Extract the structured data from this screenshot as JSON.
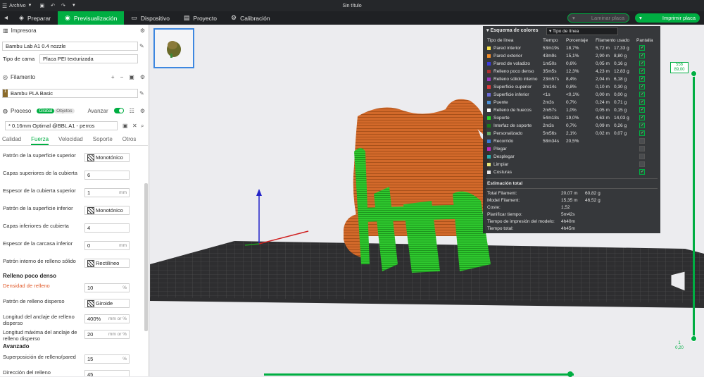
{
  "titlebar": {
    "menu_label": "Archivo",
    "title": "Sin título"
  },
  "nav": {
    "tabs": [
      {
        "label": "Preparar",
        "icon": "cube-icon"
      },
      {
        "label": "Previsualización",
        "icon": "preview-icon"
      },
      {
        "label": "Dispositivo",
        "icon": "monitor-icon"
      },
      {
        "label": "Proyecto",
        "icon": "folder-icon"
      },
      {
        "label": "Calibración",
        "icon": "calibration-icon"
      }
    ],
    "laminar_label": "Laminar placa",
    "imprimir_label": "Imprimir placa"
  },
  "sidebar": {
    "impresora_title": "Impresora",
    "printer_value": "Bambu Lab A1 0.4 nozzle",
    "bed_label": "Tipo de cama",
    "bed_value": "Placa PEI texturizada",
    "filamento_title": "Filamento",
    "filament_num": "1",
    "filament_value": "Bambu PLA Basic",
    "filament_color": "#8a6a2a",
    "proceso_title": "Proceso",
    "global_label": "Global",
    "objetos_label": "Objetos",
    "avanzar_label": "Avanzar",
    "process_value": "* 0.16mm Optimal @BBL A1 - perros",
    "tabs": [
      "Calidad",
      "Fuerza",
      "Velocidad",
      "Soporte",
      "Otros"
    ],
    "params": [
      {
        "label": "Patrón de la superficie superior",
        "value": "Monotónico",
        "unit": "",
        "pattern": true
      },
      {
        "label": "Capas superiores de la cubierta",
        "value": "6",
        "unit": "",
        "pattern": false
      },
      {
        "label": "Espesor de la cubierta superior",
        "value": "1",
        "unit": "mm",
        "pattern": false
      },
      {
        "label": "Patrón de la superficie inferior",
        "value": "Monotónico",
        "unit": "",
        "pattern": true
      },
      {
        "label": "Capas inferiores de cubierta",
        "value": "4",
        "unit": "",
        "pattern": false
      },
      {
        "label": "Espesor de la carcasa inferior",
        "value": "0",
        "unit": "mm",
        "pattern": false
      },
      {
        "label": "Patrón interno de relleno sólido",
        "value": "Rectilíneo",
        "unit": "",
        "pattern": true
      }
    ],
    "relleno_head": "Relleno poco denso",
    "relleno_params": [
      {
        "label": "Densidad de relleno",
        "value": "10",
        "unit": "%",
        "pattern": false
      },
      {
        "label": "Patrón de relleno disperso",
        "value": "Giroide",
        "unit": "",
        "pattern": true
      },
      {
        "label": "Longitud del anclaje de relleno disperso",
        "value": "400%",
        "unit": "mm or %",
        "pattern": false
      },
      {
        "label": "Longitud máxima del anclaje de relleno disperso",
        "value": "20",
        "unit": "mm or %",
        "pattern": false
      }
    ],
    "avanzado_head": "Avanzado",
    "avanzado_params": [
      {
        "label": "Superposición de relleno/pared",
        "value": "15",
        "unit": "%"
      },
      {
        "label": "Dirección del relleno",
        "value": "45",
        "unit": ""
      }
    ]
  },
  "thumbnail": {
    "index": "1"
  },
  "legend": {
    "title": "Esquema de colores",
    "mode": "Tipo de línea",
    "headers": [
      "Tipo de línea",
      "Tiempo",
      "Porcentaje",
      "Filamento usado",
      "Pantalla"
    ],
    "rows": [
      {
        "name": "Pared interior",
        "color": "#f5e04a",
        "time": "53m19s",
        "pct": "18,7%",
        "len": "5,72 m",
        "wt": "17,33 g",
        "show": true
      },
      {
        "name": "Pared exterior",
        "color": "#f28c2a",
        "time": "43m9s",
        "pct": "15,1%",
        "len": "2,90 m",
        "wt": "8,80 g",
        "show": true
      },
      {
        "name": "Pared de voladizo",
        "color": "#3b3be0",
        "time": "1m50s",
        "pct": "0,6%",
        "len": "0,05 m",
        "wt": "0,16 g",
        "show": true
      },
      {
        "name": "Relleno poco denso",
        "color": "#b03030",
        "time": "35m5s",
        "pct": "12,3%",
        "len": "4,23 m",
        "wt": "12,83 g",
        "show": true
      },
      {
        "name": "Relleno sólido interno",
        "color": "#9a3ac0",
        "time": "23m57s",
        "pct": "8,4%",
        "len": "2,04 m",
        "wt": "6,18 g",
        "show": true
      },
      {
        "name": "Superficie superior",
        "color": "#e03a3a",
        "time": "2m14s",
        "pct": "0,8%",
        "len": "0,10 m",
        "wt": "0,30 g",
        "show": true
      },
      {
        "name": "Superficie inferior",
        "color": "#6a6ad8",
        "time": "<1s",
        "pct": "<0,1%",
        "len": "0,00 m",
        "wt": "0,00 g",
        "show": true
      },
      {
        "name": "Puente",
        "color": "#4a90d8",
        "time": "2m3s",
        "pct": "0,7%",
        "len": "0,24 m",
        "wt": "0,71 g",
        "show": true
      },
      {
        "name": "Relleno de huecos",
        "color": "#ffffff",
        "time": "2m57s",
        "pct": "1,0%",
        "len": "0,05 m",
        "wt": "0,15 g",
        "show": true
      },
      {
        "name": "Soporte",
        "color": "#2ad82a",
        "time": "54m18s",
        "pct": "19,0%",
        "len": "4,63 m",
        "wt": "14,03 g",
        "show": true
      },
      {
        "name": "Interfaz de soporte",
        "color": "#1a7a1a",
        "time": "2m3s",
        "pct": "0,7%",
        "len": "0,09 m",
        "wt": "0,26 g",
        "show": true
      },
      {
        "name": "Personalizado",
        "color": "#5fa85f",
        "time": "5m56s",
        "pct": "2,1%",
        "len": "0,02 m",
        "wt": "0,07 g",
        "show": true
      },
      {
        "name": "Recorrido",
        "color": "#3a7ad8",
        "time": "58m34s",
        "pct": "20,5%",
        "len": "",
        "wt": "",
        "show": false
      },
      {
        "name": "Plegar",
        "color": "#c02ac0",
        "time": "",
        "pct": "",
        "len": "",
        "wt": "",
        "show": false
      },
      {
        "name": "Desplegar",
        "color": "#2ab0b0",
        "time": "",
        "pct": "",
        "len": "",
        "wt": "",
        "show": false
      },
      {
        "name": "Limpiar",
        "color": "#e8e87a",
        "time": "",
        "pct": "",
        "len": "",
        "wt": "",
        "show": false
      },
      {
        "name": "Costuras",
        "color": "#e8e8e8",
        "time": "",
        "pct": "",
        "len": "",
        "wt": "",
        "show": true
      }
    ],
    "estimacion_title": "Estimación total",
    "estimates": [
      {
        "label": "Total Filament:",
        "v1": "20,07 m",
        "v2": "60,82 g"
      },
      {
        "label": "Model Filament:",
        "v1": "15,35 m",
        "v2": "46,52 g"
      },
      {
        "label": "Coste:",
        "v1": "1,52",
        "v2": ""
      },
      {
        "label": "Planificar tiempo:",
        "v1": "5m42s",
        "v2": ""
      },
      {
        "label": "Tiempo de impresión del modelo:",
        "v1": "4h40m",
        "v2": ""
      },
      {
        "label": "Tiempo total:",
        "v1": "4h45m",
        "v2": ""
      }
    ]
  },
  "layer_slider": {
    "top_layer": "556",
    "top_height": "89,00",
    "bottom_layer": "1",
    "bottom_height": "0,20"
  },
  "colors": {
    "accent": "#00ae42",
    "model_orange": "#d9722a",
    "support_green": "#2ec82e"
  }
}
